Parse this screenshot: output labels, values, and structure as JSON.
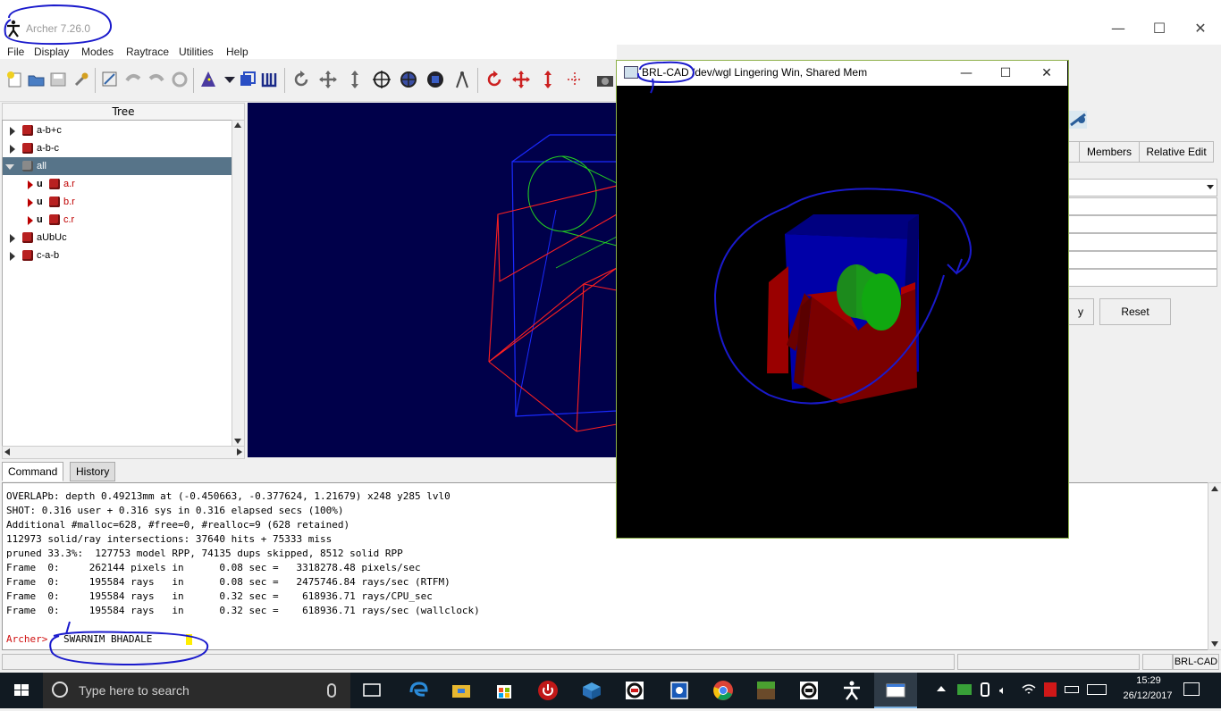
{
  "window": {
    "title": "Archer 7.26.0",
    "minimize": "—",
    "maximize": "☐",
    "close": "✕"
  },
  "menu": [
    "File",
    "Display",
    "Modes",
    "Raytrace",
    "Utilities",
    "Help"
  ],
  "tree": {
    "header": "Tree",
    "items": [
      {
        "label": "a-b+c"
      },
      {
        "label": "a-b-c"
      },
      {
        "label": "all"
      },
      {
        "op": "u",
        "label": "a.r"
      },
      {
        "op": "u",
        "label": "b.r"
      },
      {
        "op": "u",
        "label": "c.r"
      },
      {
        "label": "aUbUc"
      },
      {
        "label": "c-a-b"
      }
    ]
  },
  "right_panel": {
    "tabs": [
      "Members",
      "Relative Edit"
    ],
    "apply_partial": "y",
    "reset": "Reset"
  },
  "brl_window": {
    "title": "BRL-CAD /dev/wgl Lingering Win, Shared Mem",
    "minimize": "—",
    "maximize": "☐",
    "close": "✕"
  },
  "console": {
    "tabs": [
      "Command",
      "History"
    ],
    "lines": [
      "OVERLAPb: depth 0.49213mm at (-0.450663, -0.377624, 1.21679) x248 y285 lvl0",
      "SHOT: 0.316 user + 0.316 sys in 0.316 elapsed secs (100%)",
      "Additional #malloc=628, #free=0, #realloc=9 (628 retained)",
      "112973 solid/ray intersections: 37640 hits + 75333 miss",
      "pruned 33.3%:  127753 model RPP, 74135 dups skipped, 8512 solid RPP",
      "Frame  0:     262144 pixels in      0.08 sec =   3318278.48 pixels/sec",
      "Frame  0:     195584 rays   in      0.08 sec =   2475746.84 rays/sec (RTFM)",
      "Frame  0:     195584 rays   in      0.32 sec =    618936.71 rays/CPU_sec",
      "Frame  0:     195584 rays   in      0.32 sec =    618936.71 rays/sec (wallclock)"
    ],
    "prompt": "Archer>",
    "input": "SWARNIM BHADALE"
  },
  "status": {
    "right": "BRL-CAD"
  },
  "taskbar": {
    "search_placeholder": "Type here to search",
    "time": "15:29",
    "date": "26/12/2017"
  },
  "colors": {
    "viewport_bg": "#00004a",
    "tree_selected": "#577489",
    "annotation": "#1a1acc",
    "taskbar": "#111a22"
  }
}
